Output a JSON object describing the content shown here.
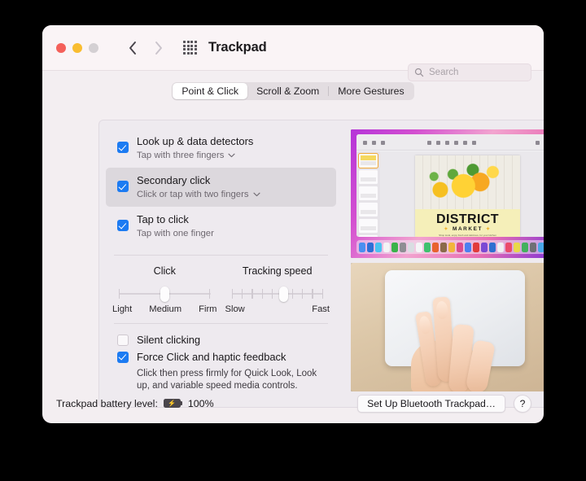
{
  "window": {
    "title": "Trackpad",
    "traffic_lights": [
      "close",
      "minimize",
      "zoom"
    ],
    "nav": {
      "back": "back-arrow",
      "forward": "forward-arrow",
      "grid": "apps-grid-icon"
    }
  },
  "search": {
    "placeholder": "Search",
    "icon": "search-icon",
    "value": ""
  },
  "tabs": [
    {
      "label": "Point & Click",
      "active": true
    },
    {
      "label": "Scroll & Zoom",
      "active": false
    },
    {
      "label": "More Gestures",
      "active": false
    }
  ],
  "options": [
    {
      "title": "Look up & data detectors",
      "subtitle": "Tap with three fingers",
      "checked": true,
      "has_menu": true,
      "selected": false
    },
    {
      "title": "Secondary click",
      "subtitle": "Click or tap with two fingers",
      "checked": true,
      "has_menu": true,
      "selected": true
    },
    {
      "title": "Tap to click",
      "subtitle": "Tap with one finger",
      "checked": true,
      "has_menu": false,
      "selected": false
    }
  ],
  "sliders": [
    {
      "label": "Click",
      "ticks": 3,
      "value_percent": 50,
      "end_labels": [
        "Light",
        "Medium",
        "Firm"
      ]
    },
    {
      "label": "Tracking speed",
      "ticks": 10,
      "value_percent": 57,
      "end_labels": [
        "Slow",
        "Fast"
      ]
    }
  ],
  "bottom_options": [
    {
      "label": "Silent clicking",
      "checked": false
    },
    {
      "label": "Force Click and haptic feedback",
      "checked": true
    }
  ],
  "force_click_description": "Click then press firmly for Quick Look, Look up, and variable speed media controls.",
  "media": {
    "top_preview": {
      "name": "keynote-presentation-preview",
      "slide_title": "DISTRICT",
      "slide_subtitle": "MARKET",
      "slide_tagline": "Shop local, enjoy fresh and delicious, for your kitchen"
    },
    "bottom_preview": {
      "name": "trackpad-two-finger-gesture-photo"
    }
  },
  "footer": {
    "battery_label": "Trackpad battery level:",
    "battery_icon": "battery-charging-icon",
    "battery_percent": "100%",
    "setup_button": "Set Up Bluetooth Trackpad…",
    "help_button": "?"
  },
  "colors": {
    "accent": "#1c7bf2",
    "window_bg": "#f3eef1",
    "panel_bg": "#eeeaef",
    "selected_row": "#dcd8dd"
  }
}
